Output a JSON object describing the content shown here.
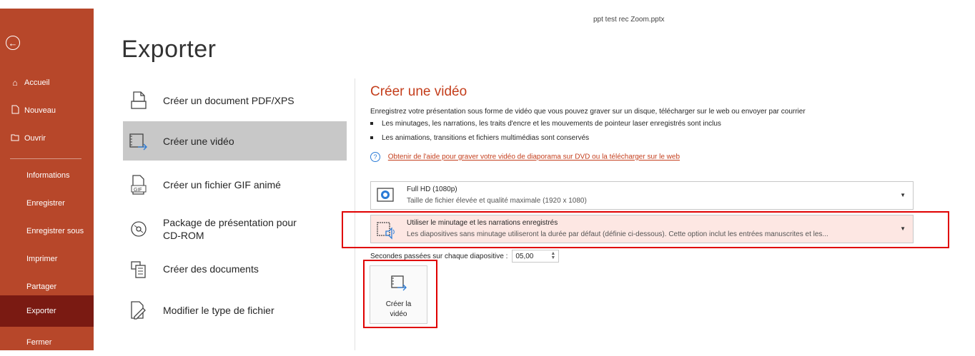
{
  "window": {
    "file_title": "ppt test rec Zoom.pptx"
  },
  "sidebar": {
    "back_icon": "back-arrow-icon",
    "items": [
      {
        "label": "Accueil",
        "icon": "home-icon"
      },
      {
        "label": "Nouveau",
        "icon": "new-document-icon"
      },
      {
        "label": "Ouvrir",
        "icon": "open-folder-icon"
      },
      {
        "label": "Informations"
      },
      {
        "label": "Enregistrer"
      },
      {
        "label": "Enregistrer sous"
      },
      {
        "label": "Imprimer"
      },
      {
        "label": "Partager"
      },
      {
        "label": "Exporter",
        "active": true
      },
      {
        "label": "Fermer"
      }
    ],
    "bg_color": "#b7472a",
    "active_color": "#7a1a12"
  },
  "page": {
    "title": "Exporter"
  },
  "export_options": [
    {
      "label": "Créer un document PDF/XPS",
      "icon": "pdf-document-icon"
    },
    {
      "label": "Créer une vidéo",
      "icon": "video-icon",
      "active": true
    },
    {
      "label": "Créer un fichier GIF animé",
      "icon": "gif-file-icon"
    },
    {
      "label_line1": "Package de présentation pour",
      "label_line2": "CD-ROM",
      "icon": "cd-rom-icon"
    },
    {
      "label": "Créer des documents",
      "icon": "handouts-icon"
    },
    {
      "label": "Modifier le type de fichier",
      "icon": "change-file-type-icon"
    }
  ],
  "video": {
    "title": "Créer une vidéo",
    "description": "Enregistrez votre présentation sous forme de vidéo que vous pouvez graver sur un disque, télécharger sur le web ou envoyer par courrier",
    "bullets": [
      "Les minutages, les narrations, les traits d'encre et les mouvements de pointeur laser enregistrés sont inclus",
      "Les animations, transitions et fichiers multimédias sont conservés"
    ],
    "help_link": "Obtenir de l'aide pour graver votre vidéo de diaporama sur DVD ou la télécharger sur le web",
    "quality": {
      "title": "Full HD (1080p)",
      "subtitle": "Taille de fichier élevée et qualité maximale (1920 x 1080)"
    },
    "timing": {
      "title": "Utiliser le minutage et les narrations enregistrés",
      "subtitle": "Les diapositives sans minutage utiliseront la durée par défaut (définie ci-dessous). Cette option inclut les entrées manuscrites et les..."
    },
    "seconds_label": "Secondes passées sur chaque diapositive :",
    "seconds_value": "05,00",
    "create_button": {
      "line1": "Créer la",
      "line2": "vidéo"
    },
    "accent_color": "#c43e1c",
    "highlight_color": "#e00000"
  }
}
